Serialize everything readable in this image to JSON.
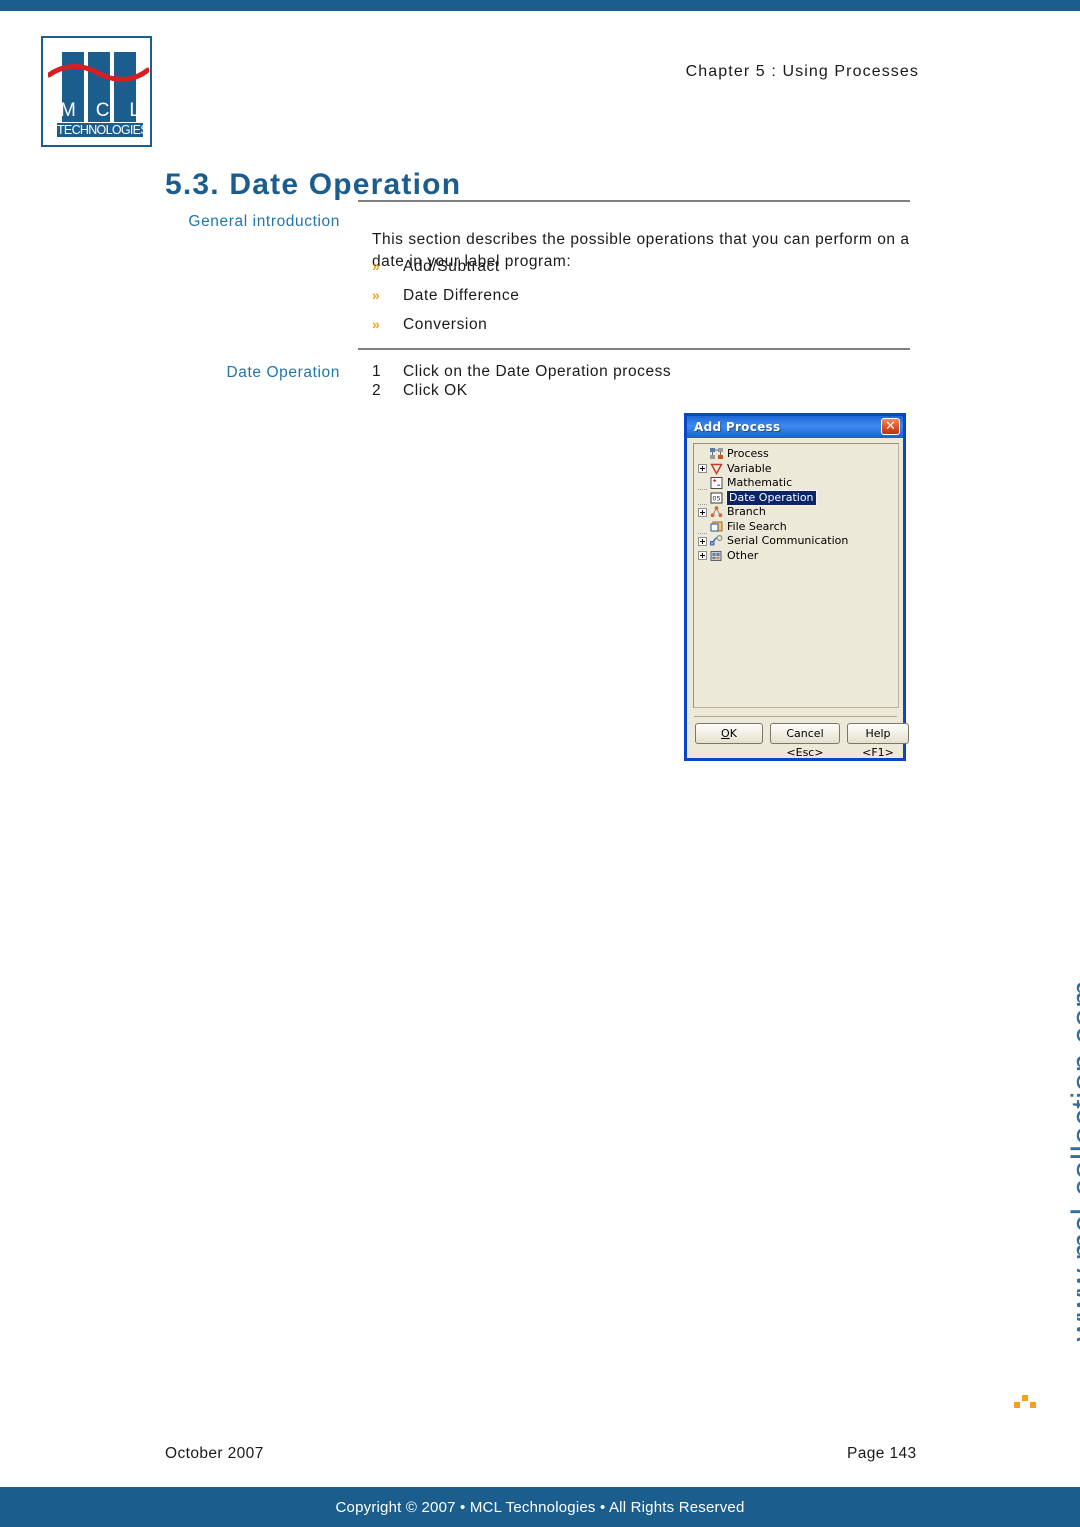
{
  "page": {
    "accent_blue": "#1b5e8e",
    "link_blue": "#2176ae",
    "bullet_orange": "#f5a11e"
  },
  "header": {
    "chapter": "Chapter 5 : Using Processes",
    "logo": {
      "m": "M",
      "c": "C",
      "l": "L",
      "tagline": "TECHNOLOGIES"
    }
  },
  "section": {
    "title": "5.3. Date Operation"
  },
  "general_introduction": {
    "label": "General introduction",
    "paragraph": "This section describes the possible operations that you can perform on a date in your label program:",
    "bullets": [
      {
        "marker": "»",
        "label": "Add/Subtract"
      },
      {
        "marker": "»",
        "label": "Date Difference"
      },
      {
        "marker": "»",
        "label": "Conversion"
      }
    ]
  },
  "date_operation": {
    "label": "Date Operation",
    "steps": [
      {
        "num": "1",
        "text": "Click on the Date Operation process"
      },
      {
        "num": "2",
        "text": "Click OK"
      }
    ]
  },
  "dialog": {
    "title": "Add Process",
    "close_glyph": "✕",
    "tree": [
      {
        "label": "Process",
        "icon": "process-icon",
        "expander": "none",
        "indent": 0,
        "selected": false
      },
      {
        "label": "Variable",
        "icon": "variable-icon",
        "expander": "plus",
        "indent": 1,
        "selected": false
      },
      {
        "label": "Mathematic",
        "icon": "mathematic-icon",
        "expander": "leaf",
        "indent": 1,
        "selected": false
      },
      {
        "label": "Date Operation",
        "icon": "date-operation-icon",
        "expander": "leaf",
        "indent": 1,
        "selected": true
      },
      {
        "label": "Branch",
        "icon": "branch-icon",
        "expander": "plus",
        "indent": 1,
        "selected": false
      },
      {
        "label": "File Search",
        "icon": "file-search-icon",
        "expander": "leaf",
        "indent": 1,
        "selected": false
      },
      {
        "label": "Serial Communication",
        "icon": "serial-communication-icon",
        "expander": "plus",
        "indent": 1,
        "selected": false
      },
      {
        "label": "Other",
        "icon": "other-icon",
        "expander": "plus",
        "indent": 1,
        "selected": false
      }
    ],
    "buttons": {
      "ok_accel": "O",
      "ok_rest": "K",
      "cancel": "Cancel <Esc>",
      "help": "Help <F1>"
    }
  },
  "watermark": {
    "text": "www.mcl-collection.com"
  },
  "footer": {
    "date": "October 2007",
    "page": "Page  143",
    "copyright": "Copyright © 2007 • MCL Technologies • All Rights Reserved"
  }
}
